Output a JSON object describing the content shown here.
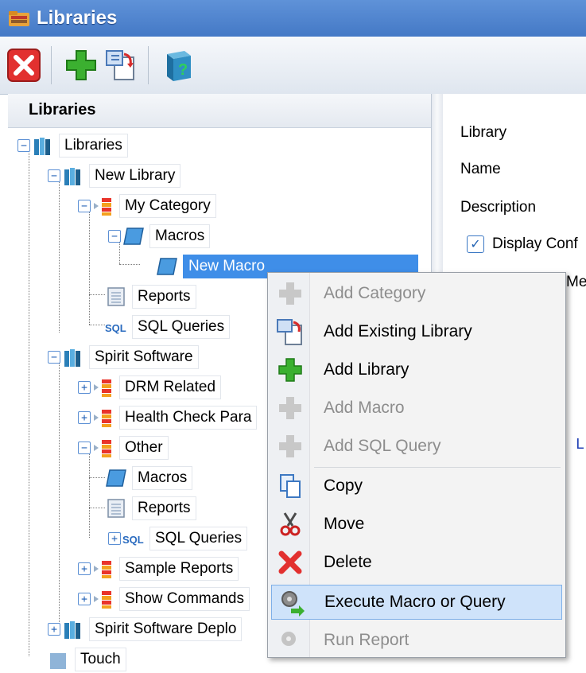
{
  "window": {
    "title": "Libraries"
  },
  "toolbar": {
    "buttons": [
      {
        "icon": "close-icon",
        "color": "#e2302f"
      },
      {
        "icon": "add-icon",
        "color": "#3bb030"
      },
      {
        "icon": "import-icon"
      },
      {
        "icon": "help-book-icon"
      }
    ]
  },
  "left_panel": {
    "header": "Libraries"
  },
  "tree": {
    "root": "Libraries",
    "new_library": "New Library",
    "my_category": "My Category",
    "macros": "Macros",
    "new_macro": "New Macro",
    "reports": "Reports",
    "sql_queries": "SQL Queries",
    "spirit_software": "Spirit Software",
    "drm_related": "DRM Related",
    "health_check": "Health Check Para",
    "other": "Other",
    "other_macros": "Macros",
    "other_reports": "Reports",
    "other_sql": "SQL Queries",
    "sample_reports": "Sample Reports",
    "show_commands": "Show Commands",
    "spirit_deploy": "Spirit Software Deplo",
    "touch": "Touch"
  },
  "right_panel": {
    "library_label": "Library",
    "name_label": "Name",
    "description_label": "Description",
    "display_conf_label": "Display Conf",
    "me_label": "Me",
    "code_char": "L"
  },
  "context_menu": {
    "items": [
      {
        "label": "Add Category",
        "enabled": false,
        "icon": "add-category-icon"
      },
      {
        "label": "Add Existing Library",
        "enabled": true,
        "icon": "add-existing-library-icon"
      },
      {
        "label": "Add Library",
        "enabled": true,
        "icon": "add-library-icon"
      },
      {
        "label": "Add Macro",
        "enabled": false,
        "icon": "add-macro-icon"
      },
      {
        "label": "Add SQL Query",
        "enabled": false,
        "icon": "add-sql-query-icon"
      },
      {
        "label": "Copy",
        "enabled": true,
        "icon": "copy-icon"
      },
      {
        "label": "Move",
        "enabled": true,
        "icon": "scissors-icon"
      },
      {
        "label": "Delete",
        "enabled": true,
        "icon": "delete-icon"
      },
      {
        "label": "Execute Macro or Query",
        "enabled": true,
        "highlighted": true,
        "icon": "execute-icon"
      },
      {
        "label": "Run Report",
        "enabled": false,
        "icon": "run-report-icon"
      }
    ]
  },
  "colors": {
    "titlebar": "#4f86d0",
    "selection": "#3f8ee8",
    "menu_highlight": "#cfe3fa"
  }
}
